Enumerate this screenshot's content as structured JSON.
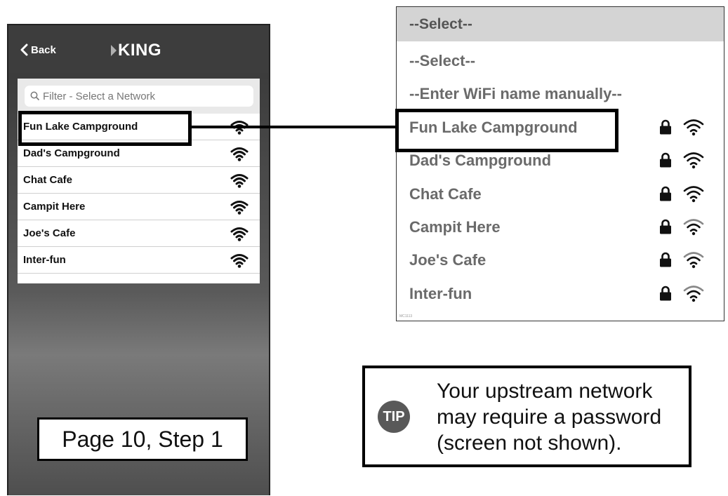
{
  "phone": {
    "back_label": "Back",
    "logo_text": "KING",
    "filter_placeholder": "Filter - Select a Network",
    "networks": [
      {
        "name": "Fun Lake Campground",
        "icon": "wifi-icon"
      },
      {
        "name": "Dad's Campground",
        "icon": "wifi-icon"
      },
      {
        "name": "Chat Cafe",
        "icon": "wifi-icon"
      },
      {
        "name": "Campit Here",
        "icon": "wifi-icon"
      },
      {
        "name": "Joe's Cafe",
        "icon": "wifi-icon"
      },
      {
        "name": "Inter-fun",
        "icon": "wifi-icon"
      }
    ],
    "highlighted_network": "Fun Lake Campground",
    "step_label": "Page 10, Step 1"
  },
  "dropdown": {
    "selected_value": "--Select--",
    "options": [
      {
        "label": "--Select--"
      },
      {
        "label": "--Enter WiFi name manually--"
      },
      {
        "label": "Fun Lake Campground",
        "locked": true,
        "signal_bars": 3
      },
      {
        "label": "Dad's Campground",
        "locked": true,
        "signal_bars": 3
      },
      {
        "label": "Chat Cafe",
        "locked": true,
        "signal_bars": 3
      },
      {
        "label": "Campit Here",
        "locked": true,
        "signal_bars": 2
      },
      {
        "label": "Joe's Cafe",
        "locked": true,
        "signal_bars": 2
      },
      {
        "label": "Inter-fun",
        "locked": true,
        "signal_bars": 2
      }
    ],
    "footnote": "MC1113"
  },
  "tip": {
    "badge": "TIP",
    "lines": [
      "Your upstream network",
      "may require a password",
      "(screen not shown)."
    ]
  },
  "colors": {
    "nav_bg": "#3d3d3d",
    "dropdown_header_bg": "#d4d4d4",
    "dropdown_text": "#6a6a6a",
    "tip_badge": "#595959",
    "highlight_border": "#000000"
  }
}
